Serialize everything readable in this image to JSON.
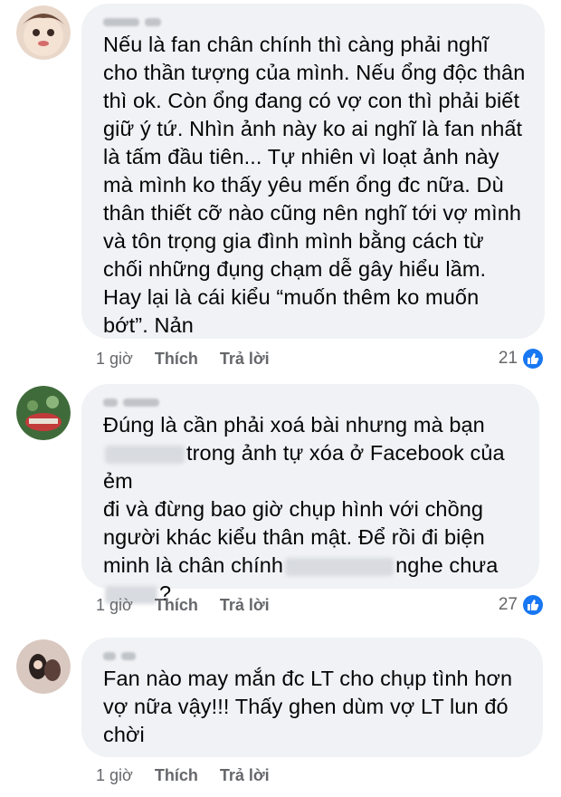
{
  "colors": {
    "bubble": "#f0f2f5",
    "text": "#050505",
    "meta": "#65676b",
    "like": "#1877f2"
  },
  "comments": [
    {
      "text_lines": [
        "Nếu là fan chân chính thì càng phải nghĩ",
        "cho thần tượng của mình. Nếu ổng độc thân",
        "thì ok. Còn ổng đang có vợ con thì phải biết",
        "giữ ý tứ. Nhìn ảnh này ko ai nghĩ là fan nhất",
        "là tấm đầu tiên... Tự nhiên vì loạt ảnh này",
        "mà mình ko thấy yêu mến ổng đc nữa. Dù",
        "thân thiết cỡ nào cũng nên nghĩ tới vợ mình",
        "và tôn trọng gia đình mình bằng cách từ",
        "chối những đụng chạm dễ gây hiểu lầm.",
        "Hay lại là cái kiểu “muốn thêm ko muốn",
        "bớt”. Nản"
      ],
      "time": "1 giờ",
      "like_label": "Thích",
      "reply_label": "Trả lời",
      "reaction_count": "21",
      "reaction_icon": "thumbs-up-icon"
    },
    {
      "text_lines": [
        "Đúng là cần phải xoá bài nhưng mà bạn",
        "trong ảnh tự xóa ở Facebook của ẻm",
        "đi và đừng bao giờ chụp hình với chồng",
        "người khác kiểu thân mật. Để rồi đi biện",
        "minh là chân chính",
        "nghe chưa",
        "?"
      ],
      "time": "1 giờ",
      "like_label": "Thích",
      "reply_label": "Trả lời",
      "reaction_count": "27",
      "reaction_icon": "thumbs-up-icon"
    },
    {
      "text_lines": [
        "Fan nào may mắn đc LT cho chụp tình hơn",
        "vợ nữa vậy!!! Thấy ghen dùm vợ LT lun đó",
        "chời"
      ],
      "time": "1 giờ",
      "like_label": "Thích",
      "reply_label": "Trả lời"
    }
  ]
}
